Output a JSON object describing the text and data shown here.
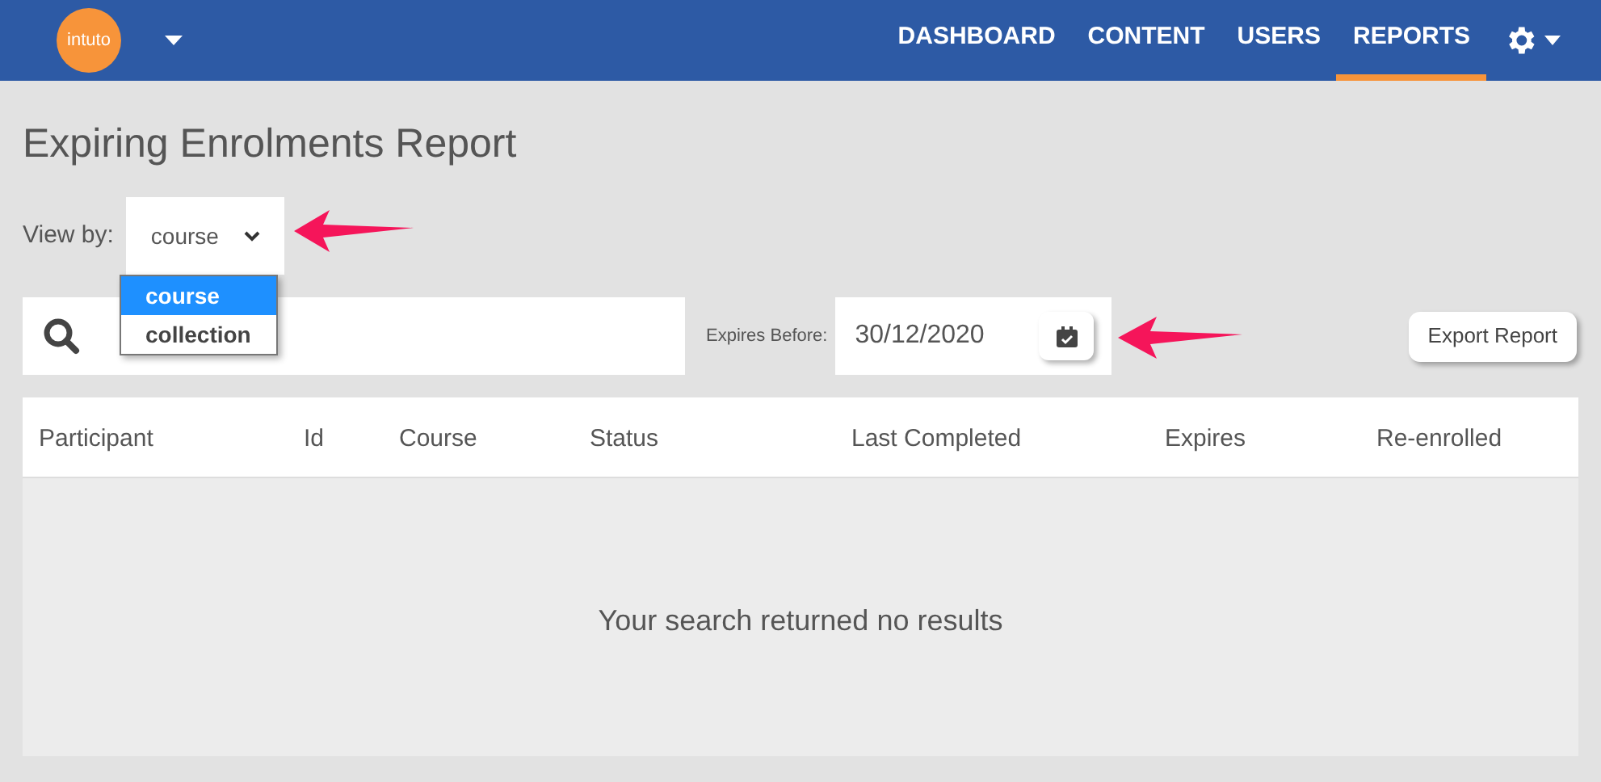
{
  "navbar": {
    "logo": "intuto",
    "items": [
      {
        "label": "DASHBOARD",
        "selected": false
      },
      {
        "label": "CONTENT",
        "selected": false
      },
      {
        "label": "USERS",
        "selected": false
      },
      {
        "label": "REPORTS",
        "selected": true
      }
    ]
  },
  "page_title": "Expiring Enrolments Report",
  "view_by": {
    "label": "View by:",
    "value": "course",
    "options": [
      {
        "label": "course",
        "selected": true
      },
      {
        "label": "collection",
        "selected": false
      }
    ]
  },
  "expires_before": {
    "label": "Expires Before:",
    "value": "30/12/2020"
  },
  "export_button": "Export Report",
  "table": {
    "columns": [
      "Participant",
      "Id",
      "Course",
      "Status",
      "Last Completed",
      "Expires",
      "Re-enrolled"
    ],
    "empty_message": "Your search returned no results"
  }
}
